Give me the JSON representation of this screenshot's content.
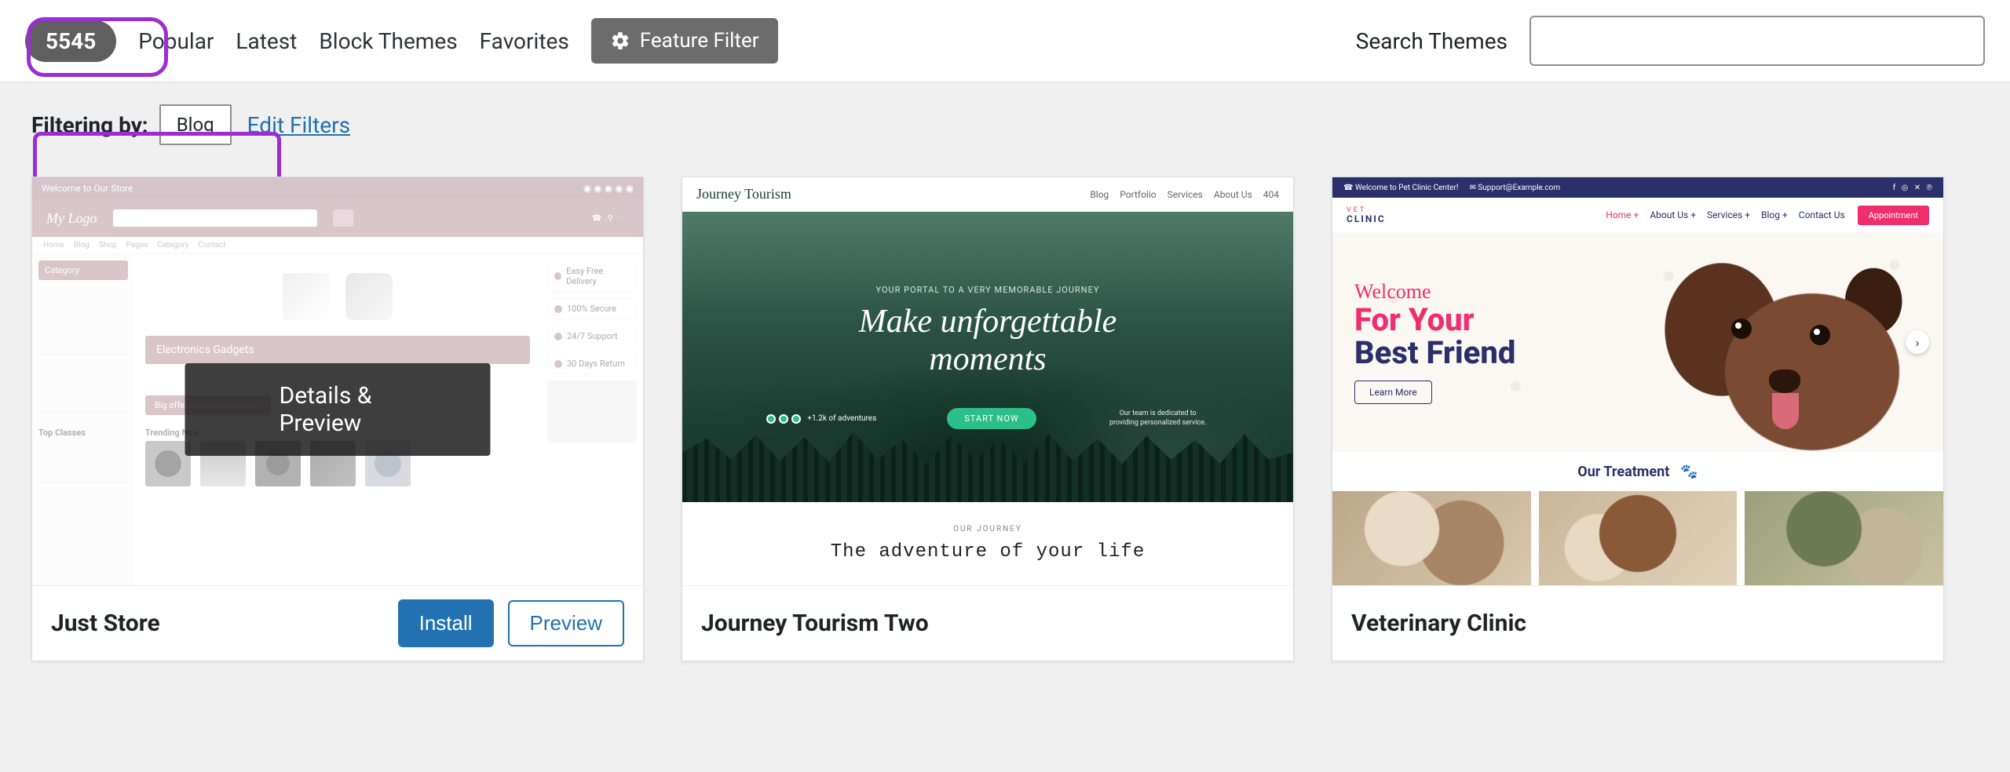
{
  "toolbar": {
    "count": "5545",
    "tabs": [
      "Popular",
      "Latest",
      "Block Themes",
      "Favorites"
    ],
    "feature_filter": "Feature Filter",
    "search_label": "Search Themes",
    "search_value": ""
  },
  "filter": {
    "label": "Filtering by:",
    "tag": "Blog",
    "edit": "Edit Filters"
  },
  "themes": [
    {
      "name": "Just Store",
      "hover": {
        "details": "Details & Preview"
      },
      "actions": {
        "install": "Install",
        "preview": "Preview"
      },
      "thumb": {
        "top_welcome": "Welcome to Our Store",
        "logo": "My Logo",
        "nav": [
          "Home",
          "Blog",
          "Shop",
          "Pages",
          "Category",
          "Contact"
        ],
        "cat_head": "Category",
        "banner": "Electronics Gadgets",
        "offer": "Big offers on new collection",
        "trending": "Trending Now",
        "side": [
          "Easy Free Delivery",
          "100% Secure",
          "24/7 Support",
          "30 Days Return"
        ],
        "top_classes": "Top Classes"
      }
    },
    {
      "name": "Journey Tourism Two",
      "thumb": {
        "brand": "Journey Tourism",
        "nav": [
          "Blog",
          "Portfolio",
          "Services",
          "About Us",
          "404"
        ],
        "tag": "YOUR PORTAL TO A VERY MEMORABLE JOURNEY",
        "title_l1": "Make unforgettable",
        "title_l2": "moments",
        "dots_label": "+1.2k of adventures",
        "start": "START NOW",
        "blurb": "Our team is dedicated to providing personalized service.",
        "small": "OUR JOURNEY",
        "adventure": "The adventure of your life"
      }
    },
    {
      "name": "Veterinary Clinic",
      "thumb": {
        "topbar_welcome": "Welcome to Pet Clinic Center!",
        "topbar_email": "Support@Example.com",
        "brand_top": "VET",
        "brand": "CLINIC",
        "nav": [
          "Home +",
          "About Us +",
          "Services +",
          "Blog +",
          "Contact Us"
        ],
        "appt": "Appointment",
        "welcome": "Welcome",
        "line1": "For Your",
        "line2": "Best Friend",
        "learn": "Learn More",
        "treatment": "Our Treatment"
      }
    }
  ]
}
